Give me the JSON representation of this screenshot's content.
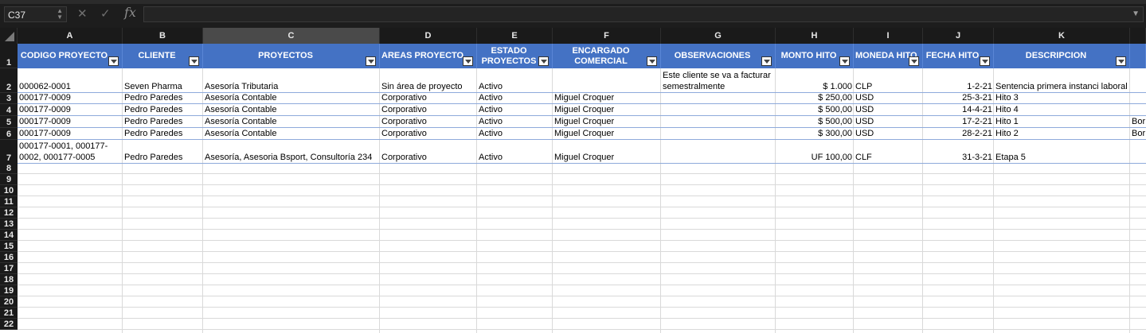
{
  "formula_bar": {
    "name_box": "C37",
    "cancel_icon": "close-icon",
    "enter_icon": "check-icon",
    "fx_label": "fx",
    "formula_value": ""
  },
  "columns": [
    "A",
    "B",
    "C",
    "D",
    "E",
    "F",
    "G",
    "H",
    "I",
    "J",
    "K",
    ""
  ],
  "selected_column": "C",
  "header_row": {
    "row_number": "1",
    "labels": [
      "CODIGO PROYECTO",
      "CLIENTE",
      "PROYECTOS",
      "AREAS PROYECTO",
      "ESTADO PROYECTOS",
      "ENCARGADO COMERCIAL",
      "OBSERVACIONES",
      "MONTO HITO",
      "MONEDA HITO",
      "FECHA HITO",
      "DESCRIPCION",
      ""
    ]
  },
  "rows": [
    {
      "num": "2",
      "cells": [
        "000062-0001",
        "Seven Pharma",
        "Asesoría Tributaria",
        "Sin área de proyecto",
        "Activo",
        "",
        "Este cliente se va a facturar semestralmente",
        "$ 1.000",
        "CLP",
        "1-2-21",
        "Sentencia primera instanci laboral",
        ""
      ]
    },
    {
      "num": "3",
      "cells": [
        "000177-0009",
        "Pedro Paredes",
        "Asesoría Contable",
        "Corporativo",
        "Activo",
        "Miguel Croquer",
        "",
        "$ 250,00",
        "USD",
        "25-3-21",
        "Hito 3",
        ""
      ]
    },
    {
      "num": "4",
      "cells": [
        "000177-0009",
        "Pedro Paredes",
        "Asesoría Contable",
        "Corporativo",
        "Activo",
        "Miguel Croquer",
        "",
        "$ 500,00",
        "USD",
        "14-4-21",
        "Hito 4",
        ""
      ]
    },
    {
      "num": "5",
      "cells": [
        "000177-0009",
        "Pedro Paredes",
        "Asesoría Contable",
        "Corporativo",
        "Activo",
        "Miguel Croquer",
        "",
        "$ 500,00",
        "USD",
        "17-2-21",
        "Hito 1",
        "Bor"
      ]
    },
    {
      "num": "6",
      "cells": [
        "000177-0009",
        "Pedro Paredes",
        "Asesoría Contable",
        "Corporativo",
        "Activo",
        "Miguel Croquer",
        "",
        "$ 300,00",
        "USD",
        "28-2-21",
        "Hito 2",
        "Bor"
      ]
    },
    {
      "num": "7",
      "cells": [
        "000177-0001, 000177-0002, 000177-0005",
        "Pedro Paredes",
        "Asesoría, Asesoria Bsport, Consultoría 234",
        "Corporativo",
        "Activo",
        "Miguel Croquer",
        "",
        "UF 100,00",
        "CLF",
        "31-3-21",
        "Etapa 5",
        ""
      ]
    }
  ],
  "empty_rows": [
    "8",
    "9",
    "10",
    "11",
    "12",
    "13",
    "14",
    "15",
    "16",
    "17",
    "18",
    "19",
    "20",
    "21",
    "22"
  ]
}
